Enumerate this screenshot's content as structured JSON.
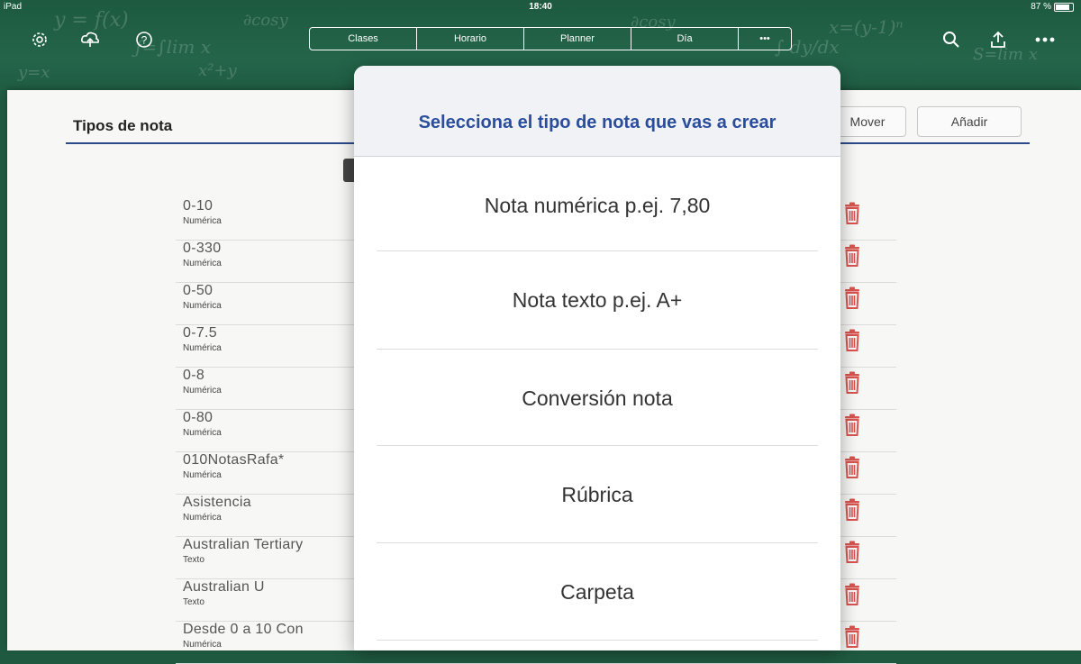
{
  "status_bar": {
    "device": "iPad",
    "time": "18:40",
    "battery": "87 %"
  },
  "toolbar": {
    "tabs": [
      "Clases",
      "Horario",
      "Planner",
      "Día",
      "•••"
    ]
  },
  "sheet": {
    "title": "Tipos de nota",
    "mover_label": "Mover",
    "add_label": "Añadir"
  },
  "grade_types": [
    {
      "name": "0-10",
      "type": "Numérica"
    },
    {
      "name": "0-330",
      "type": "Numérica"
    },
    {
      "name": "0-50",
      "type": "Numérica"
    },
    {
      "name": "0-7.5",
      "type": "Numérica"
    },
    {
      "name": "0-8",
      "type": "Numérica"
    },
    {
      "name": "0-80",
      "type": "Numérica"
    },
    {
      "name": "010NotasRafa*",
      "type": "Numérica"
    },
    {
      "name": "Asistencia",
      "type": "Numérica"
    },
    {
      "name": "Australian Tertiary",
      "type": "Texto"
    },
    {
      "name": "Australian U",
      "type": "Texto"
    },
    {
      "name": "Desde 0 a 10 Con",
      "type": "Numérica"
    }
  ],
  "popover": {
    "title": "Selecciona el tipo de nota que vas a crear",
    "options": [
      "Nota numérica p.ej. 7,80",
      "Nota texto p.ej. A+",
      "Conversión nota",
      "Rúbrica",
      "Carpeta"
    ]
  },
  "colors": {
    "board": "#1f5a40",
    "accent": "#2b4e9c",
    "trash": "#d9534f"
  }
}
